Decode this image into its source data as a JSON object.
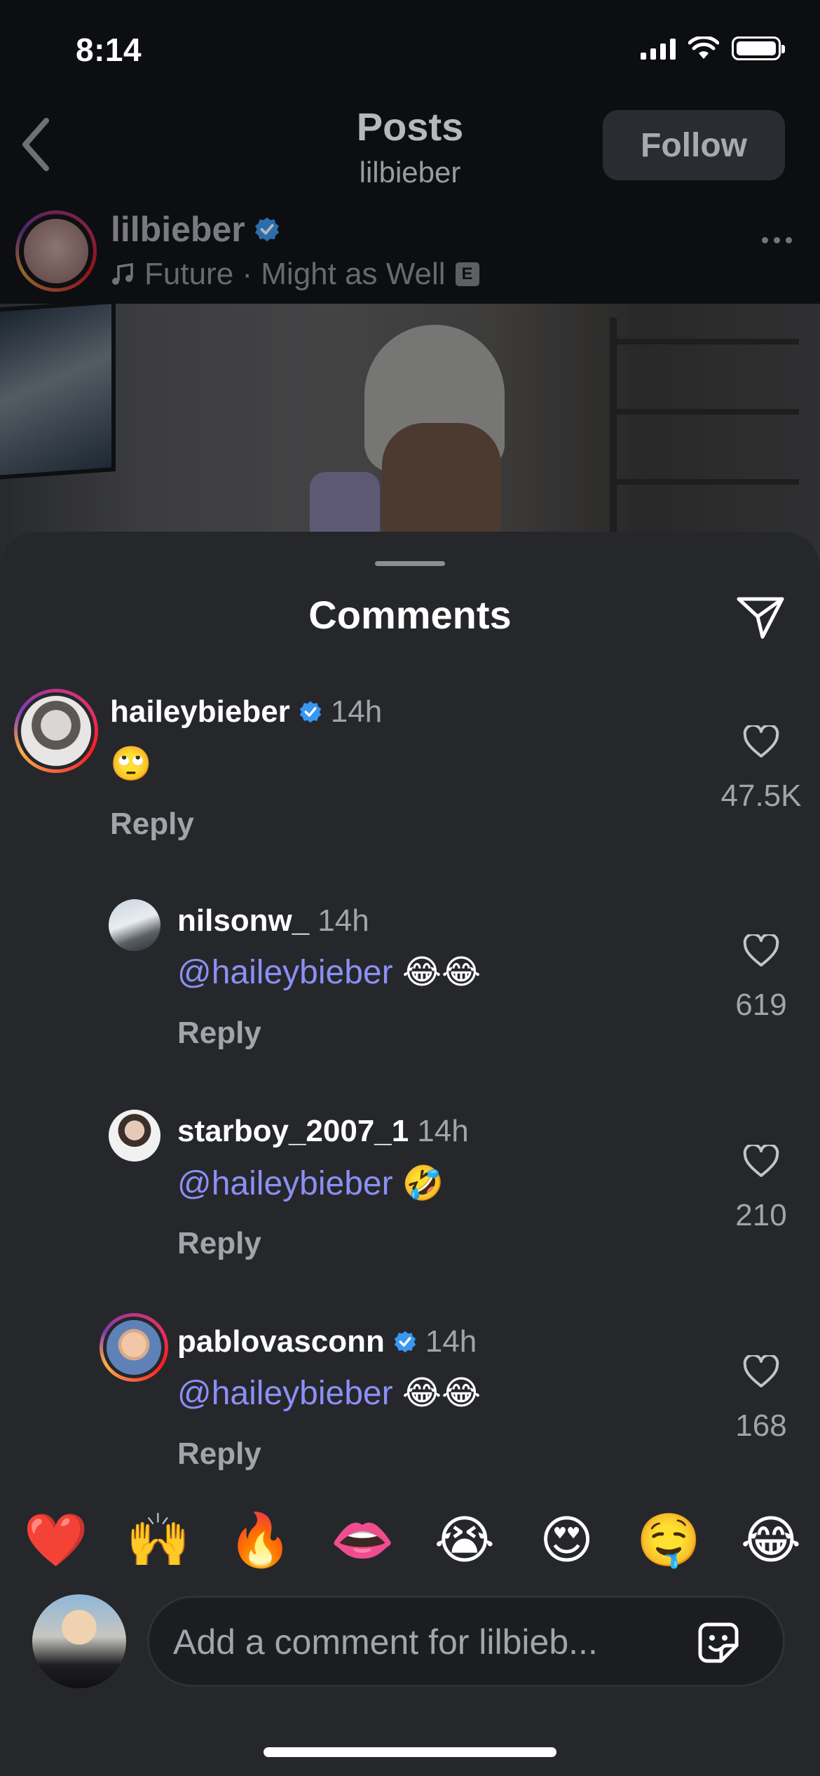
{
  "status_bar": {
    "time": "8:14"
  },
  "header": {
    "title": "Posts",
    "subtitle": "lilbieber",
    "follow_label": "Follow"
  },
  "post": {
    "username": "lilbieber",
    "verified": true,
    "music": "Future · Might as Well",
    "explicit_badge": "E"
  },
  "sheet": {
    "title": "Comments"
  },
  "comments": [
    {
      "username": "haileybieber",
      "verified": true,
      "time": "14h",
      "mention": "",
      "text": "🙄",
      "reply_label": "Reply",
      "likes": "47.5K"
    },
    {
      "username": "nilsonw_",
      "verified": false,
      "time": "14h",
      "mention": "@haileybieber",
      "text": "😂😂",
      "reply_label": "Reply",
      "likes": "619"
    },
    {
      "username": "starboy_2007_1",
      "verified": false,
      "time": "14h",
      "mention": "@haileybieber",
      "text": "🤣",
      "reply_label": "Reply",
      "likes": "210"
    },
    {
      "username": "pablovasconn",
      "verified": true,
      "time": "14h",
      "mention": "@haileybieber",
      "text": "😂😂",
      "reply_label": "Reply",
      "likes": "168"
    }
  ],
  "reactions": [
    "❤️",
    "🙌",
    "🔥",
    "👄",
    "😭",
    "😍",
    "🤤",
    "😂"
  ],
  "composer": {
    "placeholder": "Add a comment for lilbieb..."
  },
  "colors": {
    "sheet_bg": "#25272b",
    "mention": "#8c8ff4",
    "verified": "#3897f0",
    "muted_text": "#a3a4a9"
  }
}
